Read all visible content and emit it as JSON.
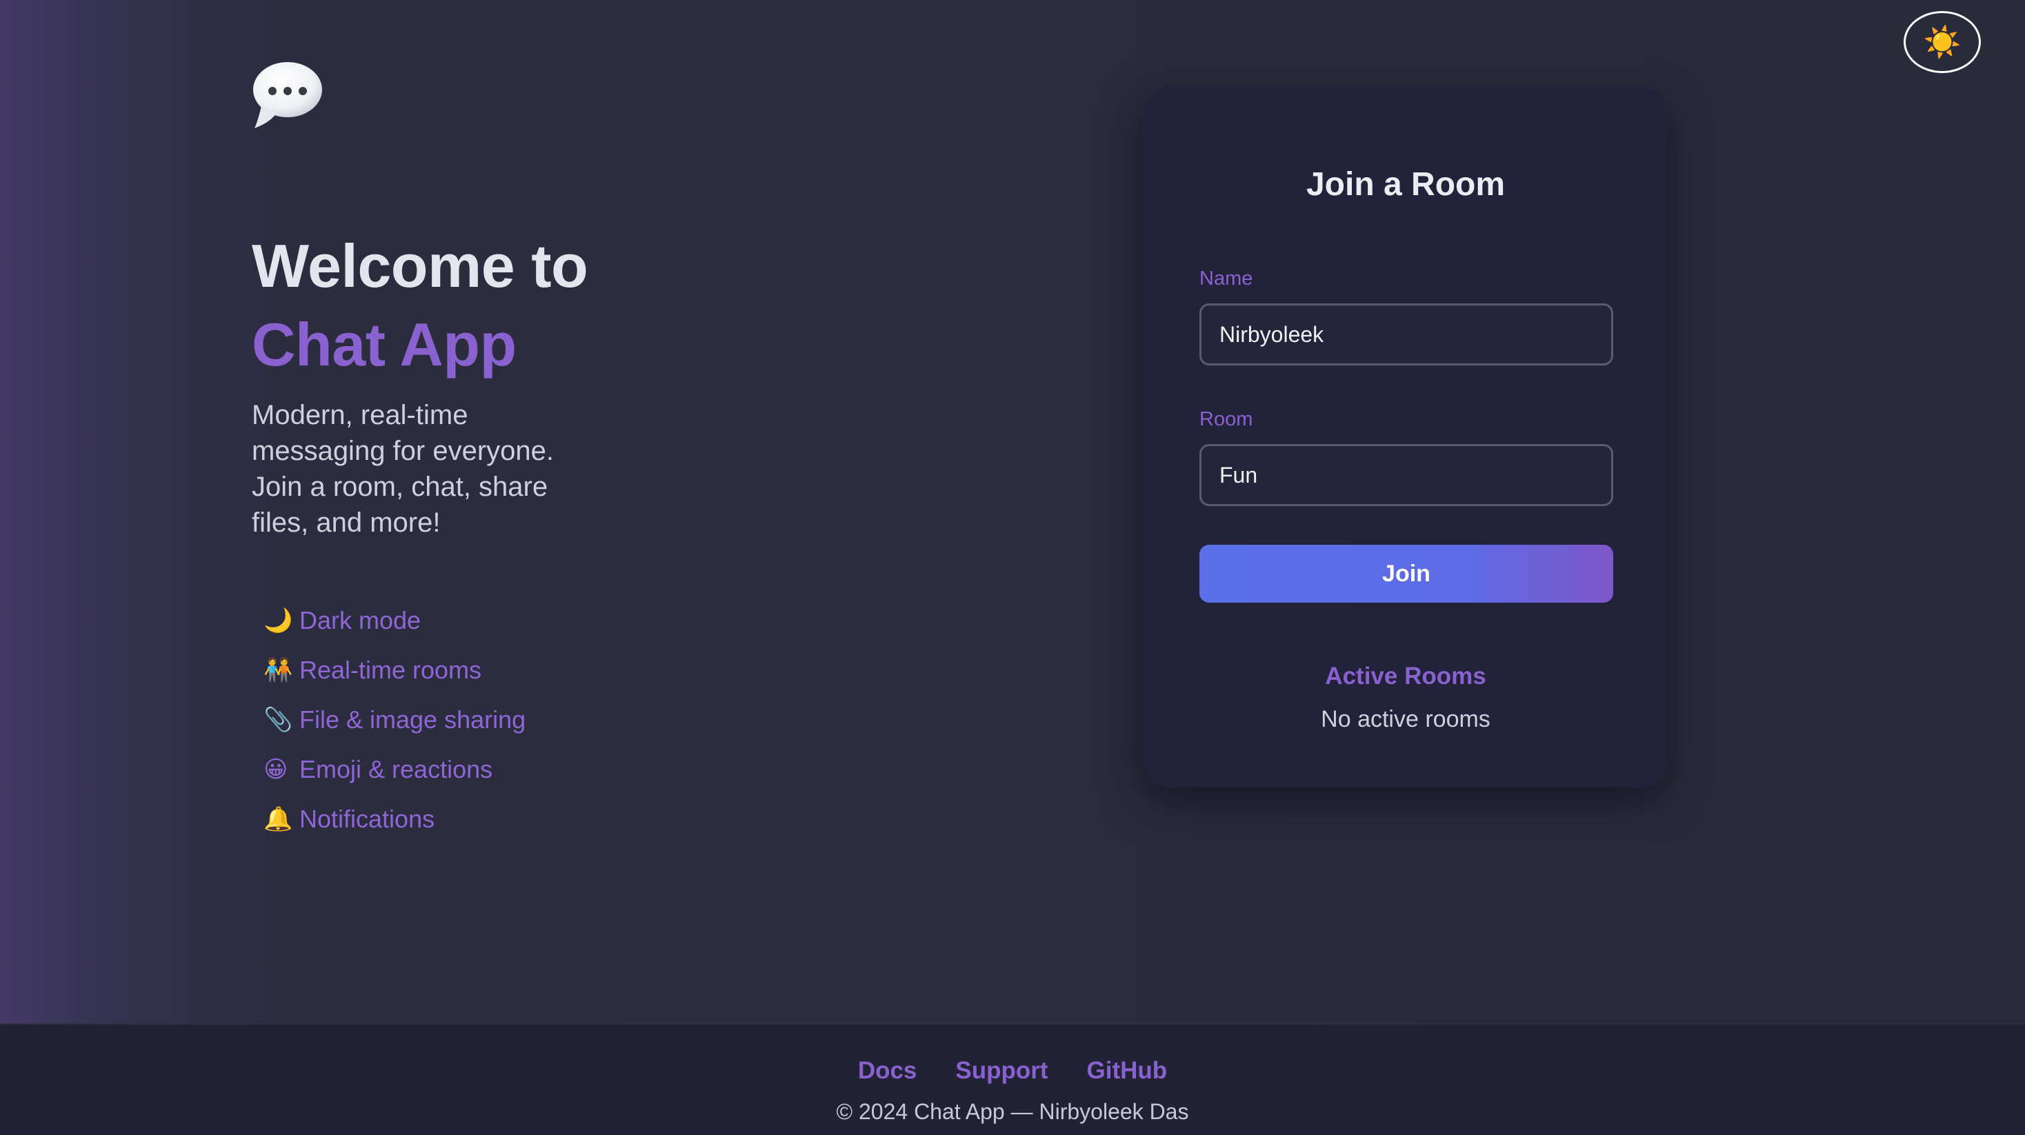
{
  "theme_toggle": {
    "icon": "sun-icon",
    "glyph": "☀️"
  },
  "hero": {
    "logo_icon": "speech-bubble-icon",
    "welcome": "Welcome to",
    "app_name": "Chat App",
    "tagline": "Modern, real-time messaging for everyone. Join a room, chat, share files, and more!",
    "features": [
      {
        "icon": "moon-icon",
        "glyph": "🌙",
        "label": "Dark mode"
      },
      {
        "icon": "people-icon",
        "glyph": "🧑‍🤝‍🧑",
        "label": "Real-time rooms"
      },
      {
        "icon": "paperclip-icon",
        "glyph": "📎",
        "label": "File & image sharing"
      },
      {
        "icon": "grinning-face-icon",
        "glyph": "😀",
        "label": "Emoji & reactions"
      },
      {
        "icon": "bell-icon",
        "glyph": "🔔",
        "label": "Notifications"
      }
    ]
  },
  "join_card": {
    "title": "Join a Room",
    "name_label": "Name",
    "name_value": "Nirbyoleek",
    "room_label": "Room",
    "room_value": "Fun",
    "join_label": "Join",
    "active_rooms_title": "Active Rooms",
    "active_rooms_empty": "No active rooms"
  },
  "footer": {
    "links": [
      "Docs",
      "Support",
      "GitHub"
    ],
    "copyright": "© 2024 Chat App — Nirbyoleek Das"
  },
  "colors": {
    "accent": "#8a62cf",
    "button_start": "#5a6fe8",
    "button_end": "#7e57c9",
    "card_bg": "#22223a",
    "page_bg": "#2a2b3a"
  }
}
